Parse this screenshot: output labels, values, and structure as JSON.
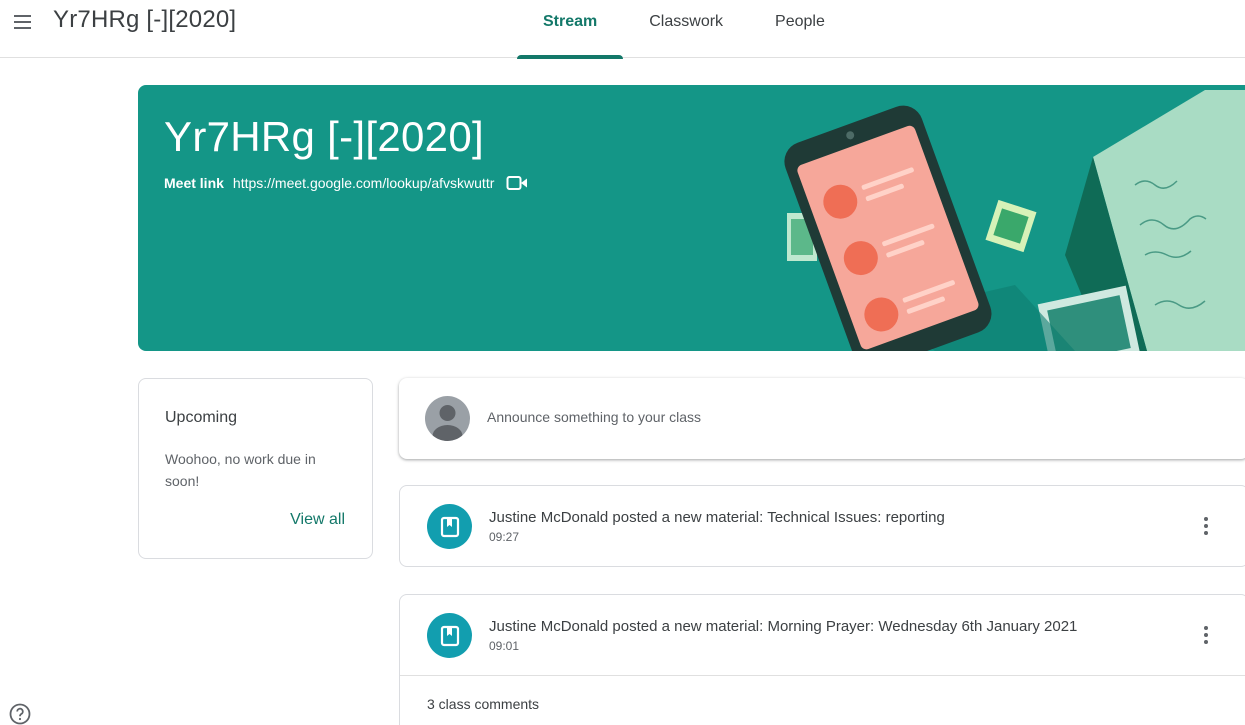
{
  "header": {
    "class_title": "Yr7HRg [-][2020]",
    "tabs": [
      {
        "label": "Stream",
        "active": true
      },
      {
        "label": "Classwork",
        "active": false
      },
      {
        "label": "People",
        "active": false
      }
    ]
  },
  "banner": {
    "title": "Yr7HRg [-][2020]",
    "meet_label": "Meet link",
    "meet_url": "https://meet.google.com/lookup/afvskwuttr",
    "color": "#149687"
  },
  "upcoming": {
    "title": "Upcoming",
    "text": "Woohoo, no work due in soon!",
    "view_all": "View all"
  },
  "announce": {
    "placeholder": "Announce something to your class"
  },
  "posts": [
    {
      "title": "Justine McDonald posted a new material: Technical Issues: reporting",
      "time": "09:27",
      "icon": "material-icon"
    },
    {
      "title": "Justine McDonald posted a new material: Morning Prayer: Wednesday 6th January 2021",
      "time": "09:01",
      "icon": "material-icon",
      "comments": "3 class comments"
    }
  ],
  "colors": {
    "accent": "#137869",
    "post_icon": "#129eaf"
  }
}
